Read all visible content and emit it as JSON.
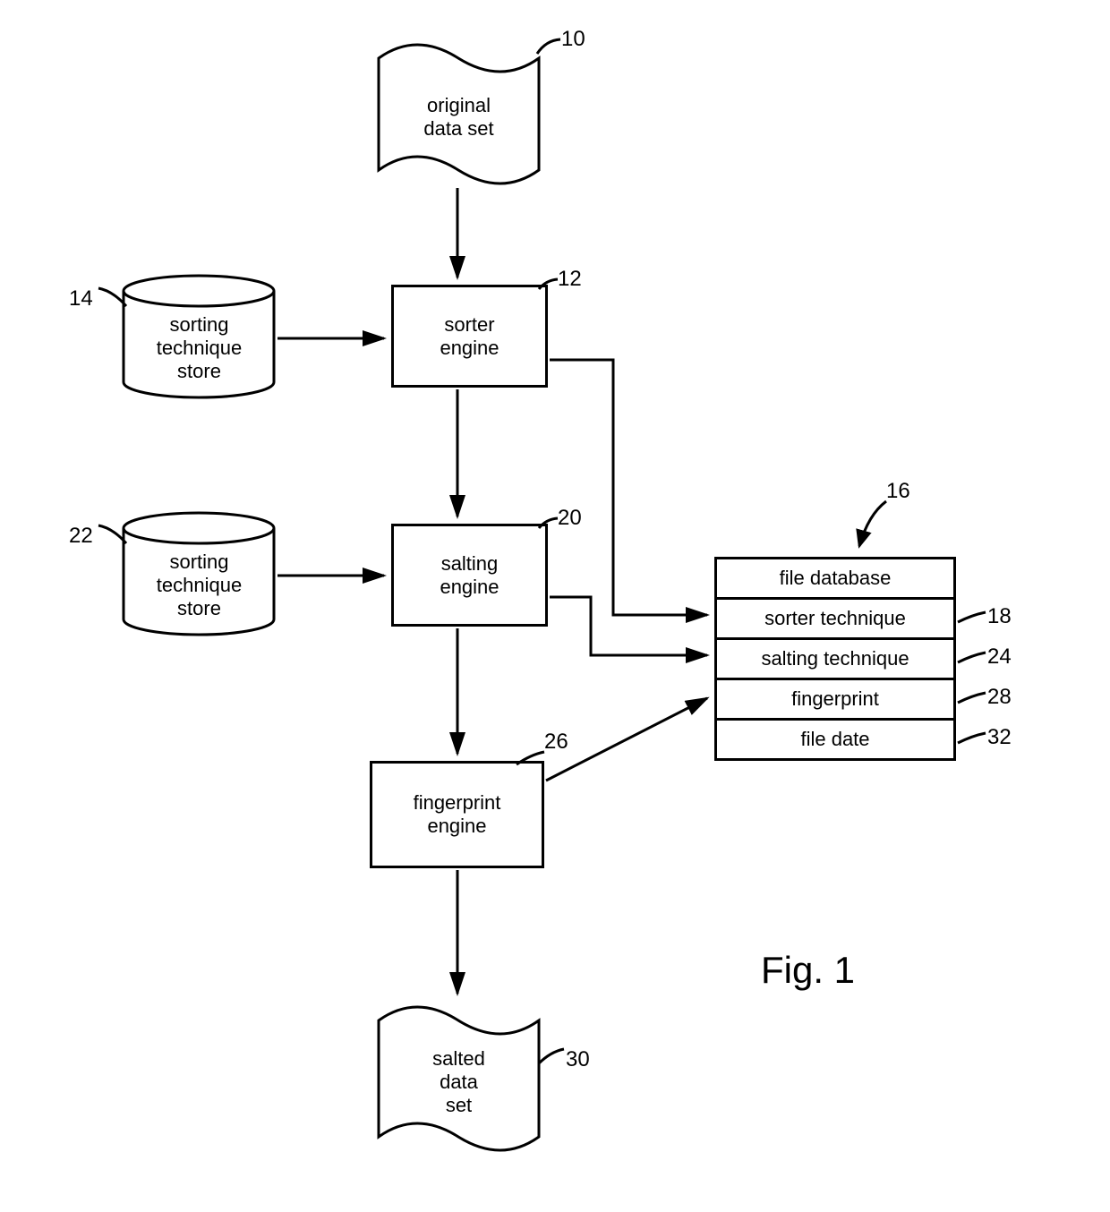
{
  "nodes": {
    "original_data_set": {
      "line1": "original",
      "line2": "data set",
      "ref": "10"
    },
    "sorter_engine": {
      "line1": "sorter",
      "line2": "engine",
      "ref": "12"
    },
    "sorting_store_1": {
      "line1": "sorting",
      "line2": "technique",
      "line3": "store",
      "ref": "14"
    },
    "sorting_store_2": {
      "line1": "sorting",
      "line2": "technique",
      "line3": "store",
      "ref": "22"
    },
    "salting_engine": {
      "line1": "salting",
      "line2": "engine",
      "ref": "20"
    },
    "fingerprint_engine": {
      "line1": "fingerprint",
      "line2": "engine",
      "ref": "26"
    },
    "salted_data_set": {
      "line1": "salted",
      "line2": "data",
      "line3": "set",
      "ref": "30"
    },
    "file_database": {
      "rows": {
        "r1": "file database",
        "r2": "sorter technique",
        "r3": "salting technique",
        "r4": "fingerprint",
        "r5": "file date"
      },
      "refs": {
        "top": "16",
        "r2": "18",
        "r3": "24",
        "r4": "28",
        "r5": "32"
      }
    }
  },
  "figure_label": "Fig. 1"
}
